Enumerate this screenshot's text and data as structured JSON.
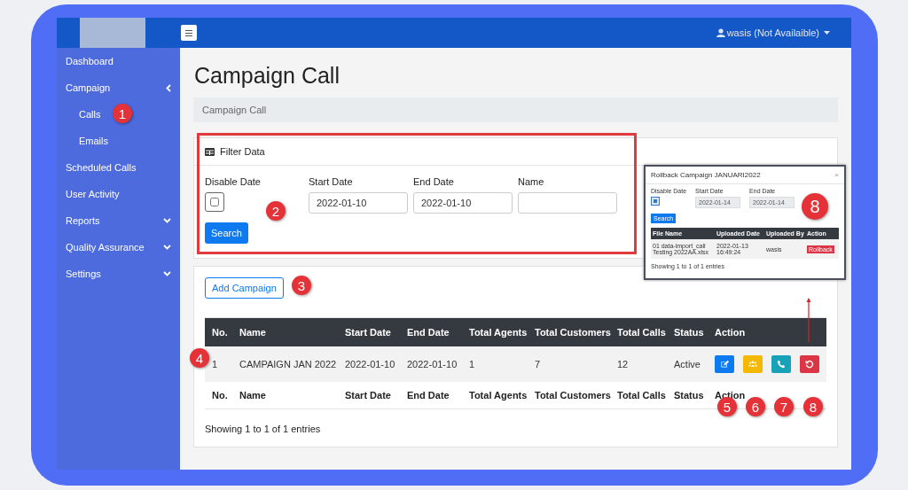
{
  "topbar": {
    "user": "wasis (Not Availaible)"
  },
  "sidebar": {
    "items": [
      {
        "label": "Dashboard"
      },
      {
        "label": "Campaign",
        "expanded": true,
        "children": [
          {
            "label": "Calls"
          },
          {
            "label": "Emails"
          }
        ]
      },
      {
        "label": "Scheduled Calls"
      },
      {
        "label": "User Activity"
      },
      {
        "label": "Reports",
        "expanded": false
      },
      {
        "label": "Quality Assurance",
        "expanded": false
      },
      {
        "label": "Settings",
        "expanded": false
      }
    ]
  },
  "page_title": "Campaign Call",
  "breadcrumb": "Campaign Call",
  "filter": {
    "title": "Filter Data",
    "disable_date": {
      "label": "Disable Date",
      "checked": false
    },
    "fields": [
      {
        "label": "Start Date",
        "value": "2022-01-10"
      },
      {
        "label": "End Date",
        "value": "2022-01-10"
      },
      {
        "label": "Name"
      }
    ],
    "search_button": "Search"
  },
  "add_button": "Add Campaign",
  "table": {
    "columns": [
      "No.",
      "Name",
      "Start Date",
      "End Date",
      "Total Agents",
      "Total Customers",
      "Total Calls",
      "Status",
      "Action"
    ],
    "rows": [
      {
        "cells": [
          "1",
          "CAMPAIGN JAN 2022",
          "2022-01-10",
          "2022-01-10",
          "1",
          "7",
          "12",
          "Active"
        ],
        "actions": [
          {
            "kind": "edit",
            "color": "#0d7af0"
          },
          {
            "kind": "group",
            "color": "#f5b800"
          },
          {
            "kind": "phone",
            "color": "#17a2b8"
          },
          {
            "kind": "rollback",
            "color": "#dc3545"
          }
        ]
      }
    ],
    "footer_columns": [
      "No.",
      "Name",
      "Start Date",
      "End Date",
      "Total Agents",
      "Total Customers",
      "Total Calls",
      "Status",
      "Action"
    ],
    "info": "Showing 1 to 1 of 1 entries"
  },
  "rollback_dialog": {
    "title": "Rollback Campaign JANUARI2022",
    "close": "×",
    "disable_date": {
      "label": "Disable Date",
      "checked": true
    },
    "fields": [
      {
        "label": "Start Date",
        "value": "2022-01-14"
      },
      {
        "label": "End Date",
        "value": "2022-01-14"
      }
    ],
    "search_button": "Search",
    "columns": [
      "File Name",
      "Uploaded Date",
      "Uploaded By",
      "Action"
    ],
    "rows": [
      {
        "cells": [
          "01 data-import_call Testing 2022AA.xlsx",
          "2022-01-13 16:49:24",
          "wasis"
        ],
        "action": "Rollback"
      }
    ],
    "info": "Showing 1 to 1 of 1 entries"
  },
  "annotations": [
    {
      "label": "1"
    },
    {
      "label": "2"
    },
    {
      "label": "3"
    },
    {
      "label": "4"
    },
    {
      "label": "5"
    },
    {
      "label": "6"
    },
    {
      "label": "7"
    },
    {
      "label": "8"
    },
    {
      "label": "8"
    }
  ]
}
